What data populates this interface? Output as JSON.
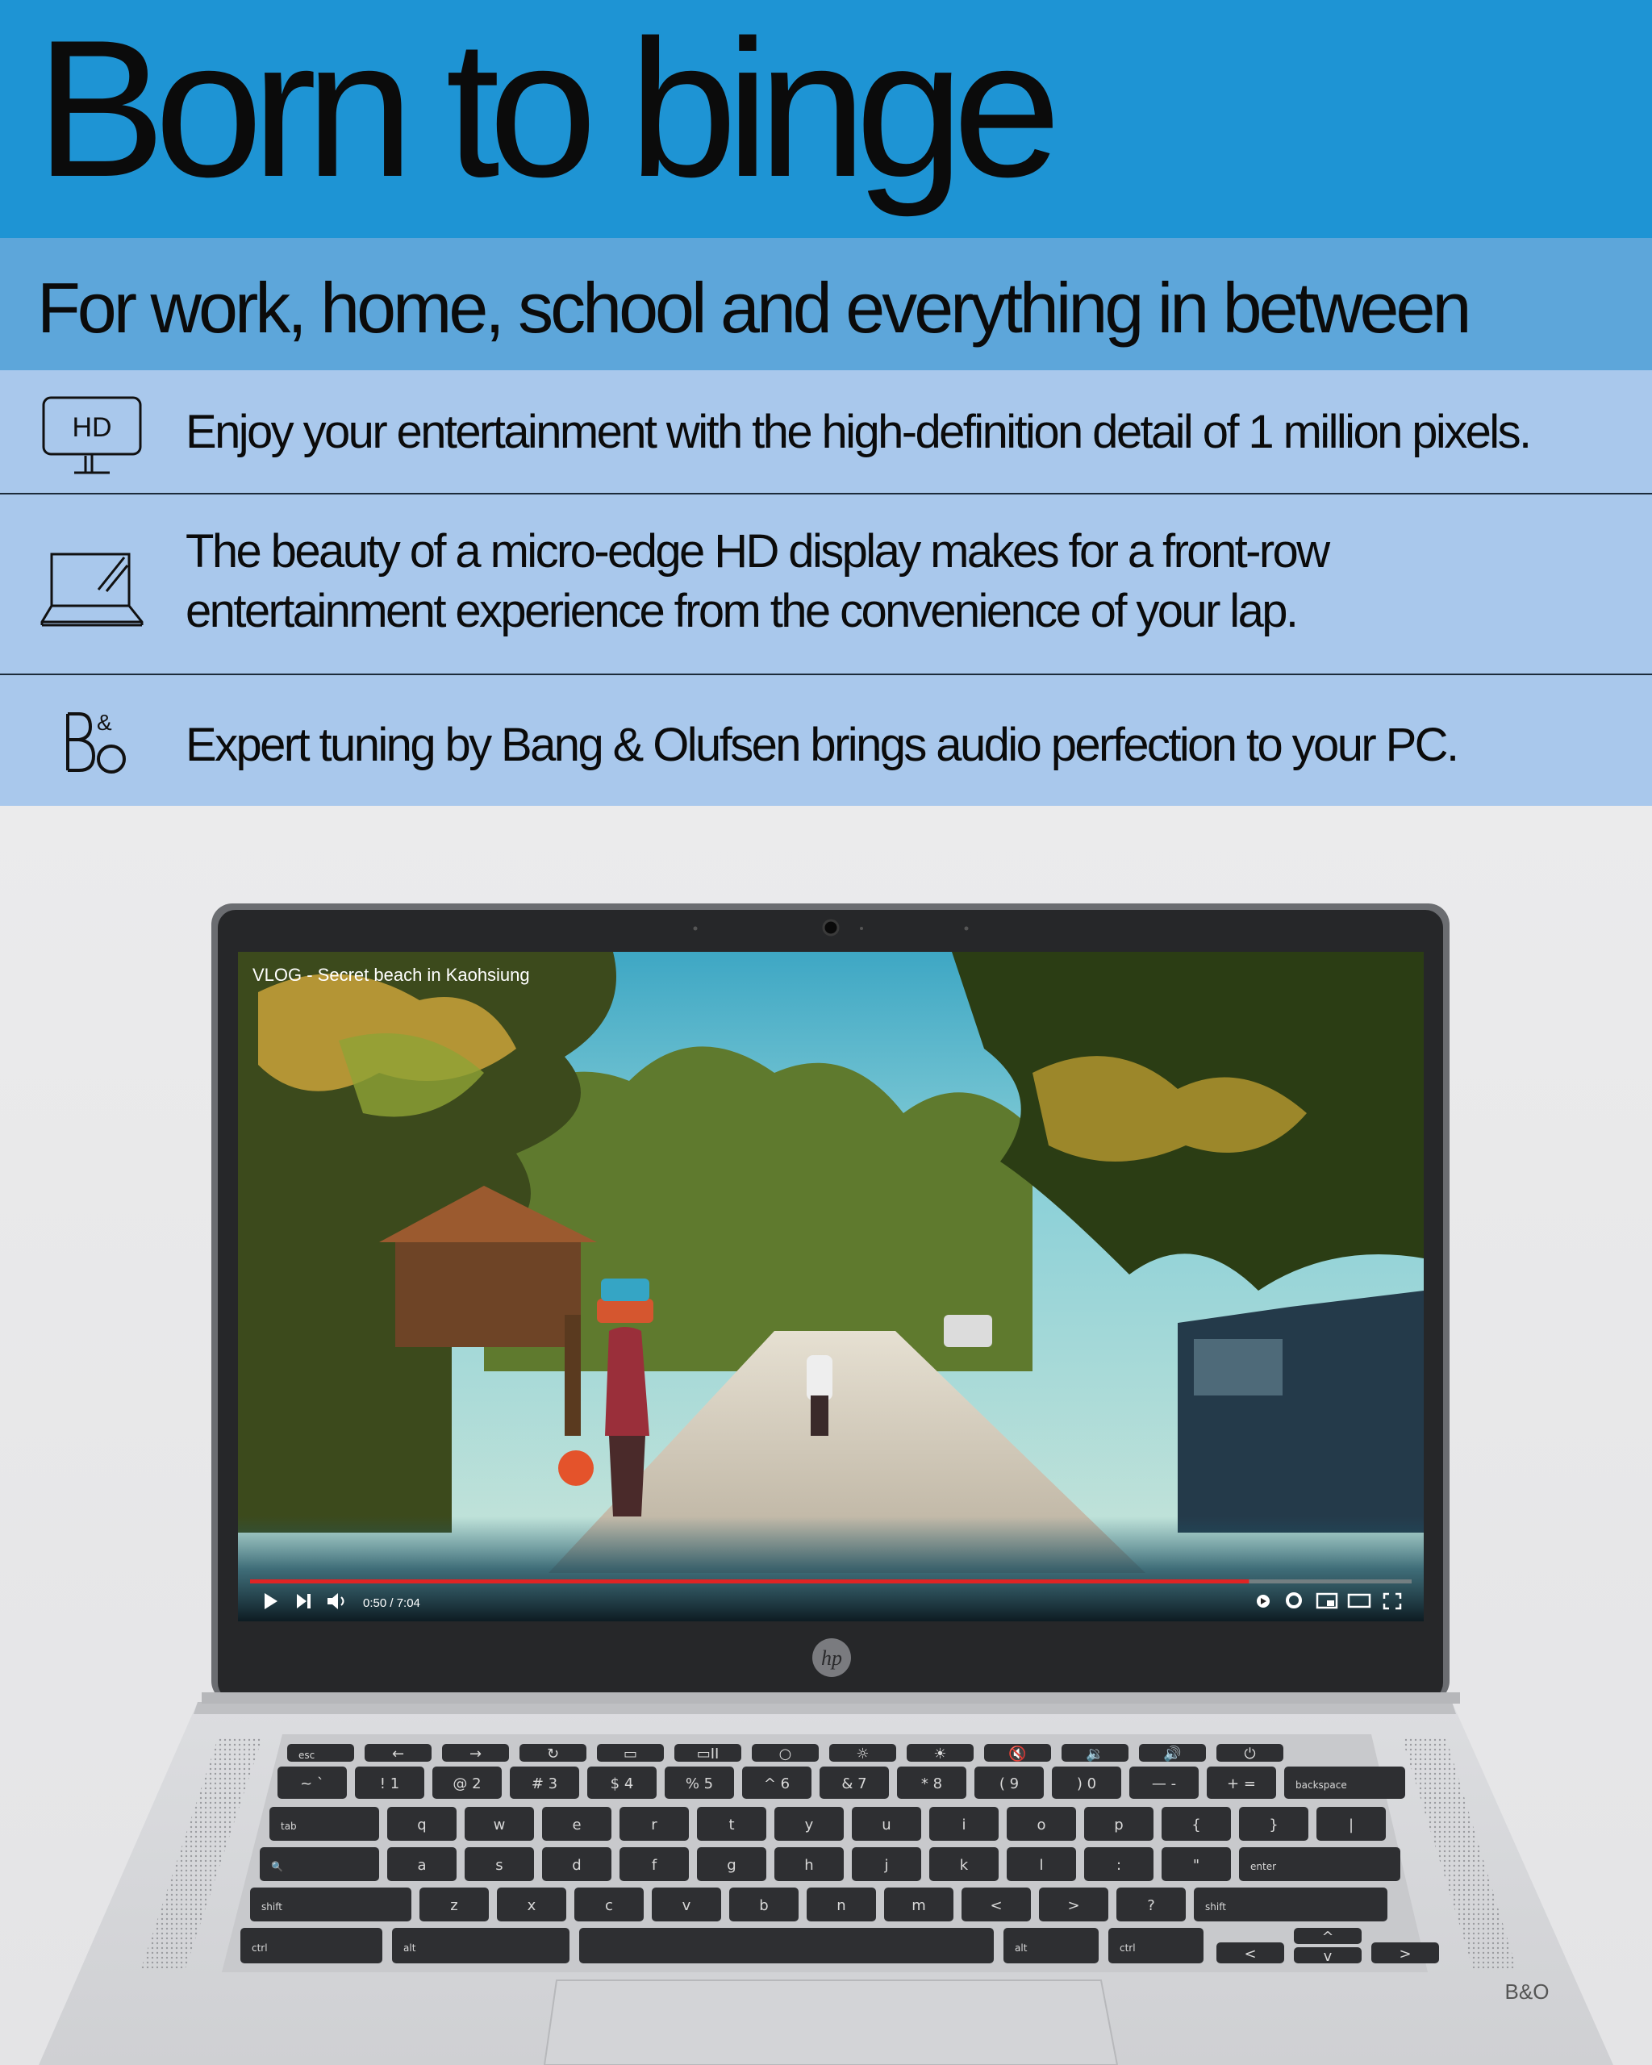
{
  "hero": {
    "title": "Born to binge"
  },
  "subtitle": {
    "text": "For work, home, school and everything in between"
  },
  "features": [
    {
      "icon": "hd-monitor-icon",
      "icon_text": "HD",
      "text": "Enjoy your entertainment with the high-definition detail of 1 million pixels."
    },
    {
      "icon": "laptop-display-icon",
      "line1": "The beauty of a micro-edge HD display makes for a front-row",
      "line2": "entertainment experience from the convenience of your lap."
    },
    {
      "icon": "bang-olufsen-logo-icon",
      "text": "Expert tuning by Bang & Olufsen brings audio perfection to your PC."
    }
  ],
  "video_player": {
    "title": "VLOG - Secret beach in Kaohsiung",
    "time": "0:50 / 7:04",
    "progress": 0.86,
    "controls": [
      "play-icon",
      "next-icon",
      "volume-icon",
      "autoplay-icon",
      "settings-gear-icon",
      "miniplayer-icon",
      "theater-mode-icon",
      "fullscreen-icon"
    ]
  },
  "laptop": {
    "brand_logo": "hp",
    "audio_badge": "B&O",
    "keyboard": {
      "row_fn": [
        "esc",
        "←",
        "→",
        "↻",
        "▭",
        "▭II",
        "○",
        "☼",
        "☀",
        "🔇",
        "🔉",
        "🔊",
        "⏻"
      ],
      "row_num_top": [
        "~",
        "!",
        "@",
        "#",
        "$",
        "%",
        "^",
        "&",
        "*",
        "(",
        ")",
        "—",
        "+",
        "backspace"
      ],
      "row_num_bottom": [
        "`",
        "1",
        "2",
        "3",
        "4",
        "5",
        "6",
        "7",
        "8",
        "9",
        "0",
        "-",
        "="
      ],
      "row_q": [
        "tab",
        "q",
        "w",
        "e",
        "r",
        "t",
        "y",
        "u",
        "i",
        "o",
        "p",
        "{",
        "}",
        "|"
      ],
      "row_a": [
        "🔍",
        "a",
        "s",
        "d",
        "f",
        "g",
        "h",
        "j",
        "k",
        "l",
        ":",
        "\"",
        "enter"
      ],
      "row_z": [
        "shift",
        "z",
        "x",
        "c",
        "v",
        "b",
        "n",
        "m",
        "<",
        ">",
        "?",
        "shift"
      ],
      "row_space": [
        "ctrl",
        "alt",
        "",
        "alt",
        "ctrl",
        "<",
        "^",
        "v",
        ">"
      ]
    }
  },
  "colors": {
    "hero_bg": "#1e94d4",
    "subtitle_bg": "#5da6da",
    "feature_bg": "#a9c8ec",
    "progress": "#e02424"
  }
}
